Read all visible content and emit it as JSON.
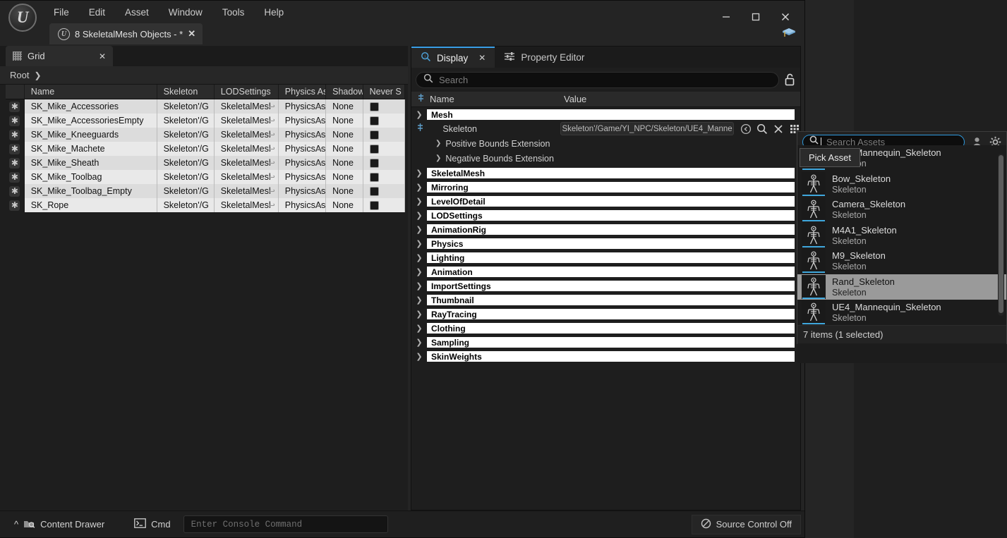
{
  "window": {
    "menu": [
      "File",
      "Edit",
      "Asset",
      "Window",
      "Tools",
      "Help"
    ],
    "document_tab": "8 SkeletalMesh Objects - *",
    "minimize": "—",
    "maximize": "□",
    "close": "✕",
    "logo_letter": "U"
  },
  "left_panel": {
    "tab_label": "Grid",
    "tab_close": "✕",
    "breadcrumb_root": "Root",
    "columns": [
      "Name",
      "Skeleton",
      "LODSettings",
      "Physics Ass",
      "Shadow",
      "Never S"
    ],
    "rows": [
      {
        "name": "SK_Mike_Accessories",
        "skeleton": "Skeleton'/G",
        "lod": "SkeletalMesl",
        "physics": "PhysicsAs",
        "shadow": "None",
        "never_stream": false
      },
      {
        "name": "SK_Mike_AccessoriesEmpty",
        "skeleton": "Skeleton'/G",
        "lod": "SkeletalMesl",
        "physics": "PhysicsAs",
        "shadow": "None",
        "never_stream": false
      },
      {
        "name": "SK_Mike_Kneeguards",
        "skeleton": "Skeleton'/G",
        "lod": "SkeletalMesl",
        "physics": "PhysicsAs",
        "shadow": "None",
        "never_stream": false
      },
      {
        "name": "SK_Mike_Machete",
        "skeleton": "Skeleton'/G",
        "lod": "SkeletalMesl",
        "physics": "PhysicsAs",
        "shadow": "None",
        "never_stream": false
      },
      {
        "name": "SK_Mike_Sheath",
        "skeleton": "Skeleton'/G",
        "lod": "SkeletalMesl",
        "physics": "PhysicsAs",
        "shadow": "None",
        "never_stream": false
      },
      {
        "name": "SK_Mike_Toolbag",
        "skeleton": "Skeleton'/G",
        "lod": "SkeletalMesl",
        "physics": "PhysicsAs",
        "shadow": "None",
        "never_stream": false
      },
      {
        "name": "SK_Mike_Toolbag_Empty",
        "skeleton": "Skeleton'/G",
        "lod": "SkeletalMesl",
        "physics": "PhysicsAs",
        "shadow": "None",
        "never_stream": false
      },
      {
        "name": "SK_Rope",
        "skeleton": "Skeleton'/G",
        "lod": "SkeletalMesl",
        "physics": "PhysicsAs",
        "shadow": "None",
        "never_stream": false
      }
    ],
    "row_icon": "✱"
  },
  "right_panel": {
    "tabs": [
      {
        "label": "Display",
        "active": true,
        "closable": true
      },
      {
        "label": "Property Editor",
        "active": false,
        "closable": false
      }
    ],
    "tab_close": "✕",
    "search_placeholder": "Search",
    "header": {
      "name": "Name",
      "value": "Value"
    },
    "mesh_category": "Mesh",
    "skeleton_label": "Skeleton",
    "skeleton_value": "Skeleton'/Game/YI_NPC/Skeleton/UE4_Manne",
    "sub_properties": [
      "Positive Bounds Extension",
      "Negative Bounds Extension"
    ],
    "categories": [
      "SkeletalMesh",
      "Mirroring",
      "LevelOfDetail",
      "LODSettings",
      "AnimationRig",
      "Physics",
      "Lighting",
      "Animation",
      "ImportSettings",
      "Thumbnail",
      "RayTracing",
      "Clothing",
      "Sampling",
      "SkinWeights"
    ]
  },
  "asset_picker": {
    "search_placeholder": "Search Assets",
    "tooltip": "Pick Asset",
    "status": "7 items (1 selected)",
    "items": [
      {
        "name": "UE4_Mannequin_Skeleton",
        "type": "Skeleton",
        "selected": false
      },
      {
        "name": "Bow_Skeleton",
        "type": "Skeleton",
        "selected": false
      },
      {
        "name": "Camera_Skeleton",
        "type": "Skeleton",
        "selected": false
      },
      {
        "name": "M4A1_Skeleton",
        "type": "Skeleton",
        "selected": false
      },
      {
        "name": "M9_Skeleton",
        "type": "Skeleton",
        "selected": false
      },
      {
        "name": "Rand_Skeleton",
        "type": "Skeleton",
        "selected": true
      },
      {
        "name": "UE4_Mannequin_Skeleton",
        "type": "Skeleton",
        "selected": false
      }
    ]
  },
  "statusbar": {
    "content_drawer": "Content Drawer",
    "cmd": "Cmd",
    "console_placeholder": "Enter Console Command",
    "source_control": "Source Control Off"
  },
  "colors": {
    "accent_blue": "#3aa0e8",
    "thumb_underline": "#3fa7dd",
    "window_bg": "#242424",
    "table_bg": "#e8e8e8"
  }
}
